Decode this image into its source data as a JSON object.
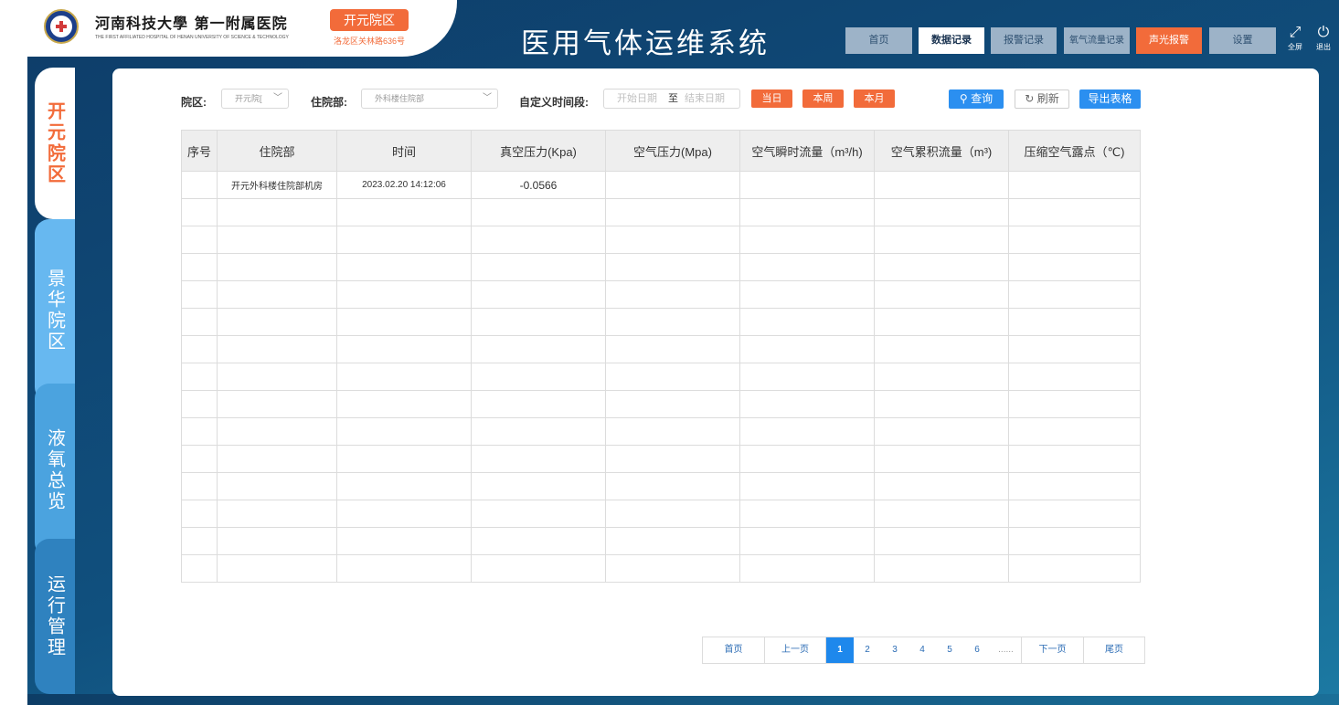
{
  "header": {
    "hospital_name": "河南科技大學 第一附属医院",
    "hospital_name_en": "THE FIRST AFFILIATED HOSPITAL OF HENAN UNIVERSITY OF SCIENCE & TECHNOLOGY",
    "campus_badge": "开元院区",
    "campus_address": "洛龙区关林路636号",
    "system_title": "医用气体运维系统",
    "nav": [
      {
        "label": "首页",
        "active": false
      },
      {
        "label": "数据记录",
        "active": true
      },
      {
        "label": "报警记录",
        "active": false
      },
      {
        "label": "氧气流量记录",
        "active": false
      },
      {
        "label": "声光报警",
        "active": false
      },
      {
        "label": "设置",
        "active": false
      }
    ],
    "fullscreen_label": "全屏",
    "logout_label": "退出"
  },
  "sidebar": {
    "tabs": [
      {
        "label": "开元院区",
        "active": true
      },
      {
        "label": "景华院区",
        "active": false
      },
      {
        "label": "液氧总览",
        "active": false
      },
      {
        "label": "运行管理",
        "active": false
      }
    ]
  },
  "filters": {
    "campus_label": "院区:",
    "campus_value": "开元院[",
    "ward_label": "住院部:",
    "ward_value": "外科楼住院部",
    "range_label": "自定义时间段:",
    "start_placeholder": "开始日期",
    "range_sep": "至",
    "end_placeholder": "结束日期",
    "today_label": "当日",
    "week_label": "本周",
    "month_label": "本月",
    "query_label": "查询",
    "refresh_label": "刷新",
    "export_label": "导出表格"
  },
  "table": {
    "columns": [
      "序号",
      "住院部",
      "时间",
      "真空压力(Kpa)",
      "空气压力(Mpa)",
      "空气瞬时流量（m³/h)",
      "空气累积流量（m³)",
      "压缩空气露点（℃)"
    ],
    "rows": [
      [
        "",
        "开元外科楼住院部机房",
        "2023.02.20  14:12:06",
        "-0.0566",
        "",
        "",
        "",
        ""
      ]
    ],
    "empty_rows": 14
  },
  "pagination": {
    "first": "首页",
    "prev": "上一页",
    "pages": [
      "1",
      "2",
      "3",
      "4",
      "5",
      "6"
    ],
    "current": "1",
    "ellipsis": "......",
    "next": "下一页",
    "last": "尾页"
  },
  "colors": {
    "accent_orange": "#f26b3a",
    "primary_blue": "#2b8ff0",
    "header_dark": "#0e3c68"
  }
}
